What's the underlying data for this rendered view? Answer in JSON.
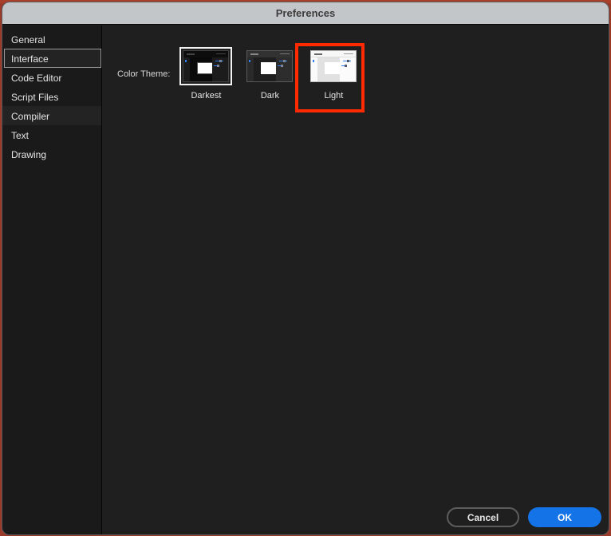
{
  "window": {
    "title": "Preferences"
  },
  "sidebar": {
    "selected": "Interface",
    "hovered": "Compiler",
    "items": [
      {
        "label": "General"
      },
      {
        "label": "Interface"
      },
      {
        "label": "Code Editor"
      },
      {
        "label": "Script Files"
      },
      {
        "label": "Compiler"
      },
      {
        "label": "Text"
      },
      {
        "label": "Drawing"
      }
    ]
  },
  "interface": {
    "color_theme_label": "Color Theme:",
    "selected_theme": "Darkest",
    "highlighted_theme": "Light",
    "highlight_color": "#ff2a00",
    "themes": [
      {
        "name": "Darkest",
        "icon": "theme-preview-darkest"
      },
      {
        "name": "Dark",
        "icon": "theme-preview-dark"
      },
      {
        "name": "Light",
        "icon": "theme-preview-light"
      }
    ]
  },
  "footer": {
    "cancel_label": "Cancel",
    "ok_label": "OK",
    "ok_color": "#1473e6"
  }
}
